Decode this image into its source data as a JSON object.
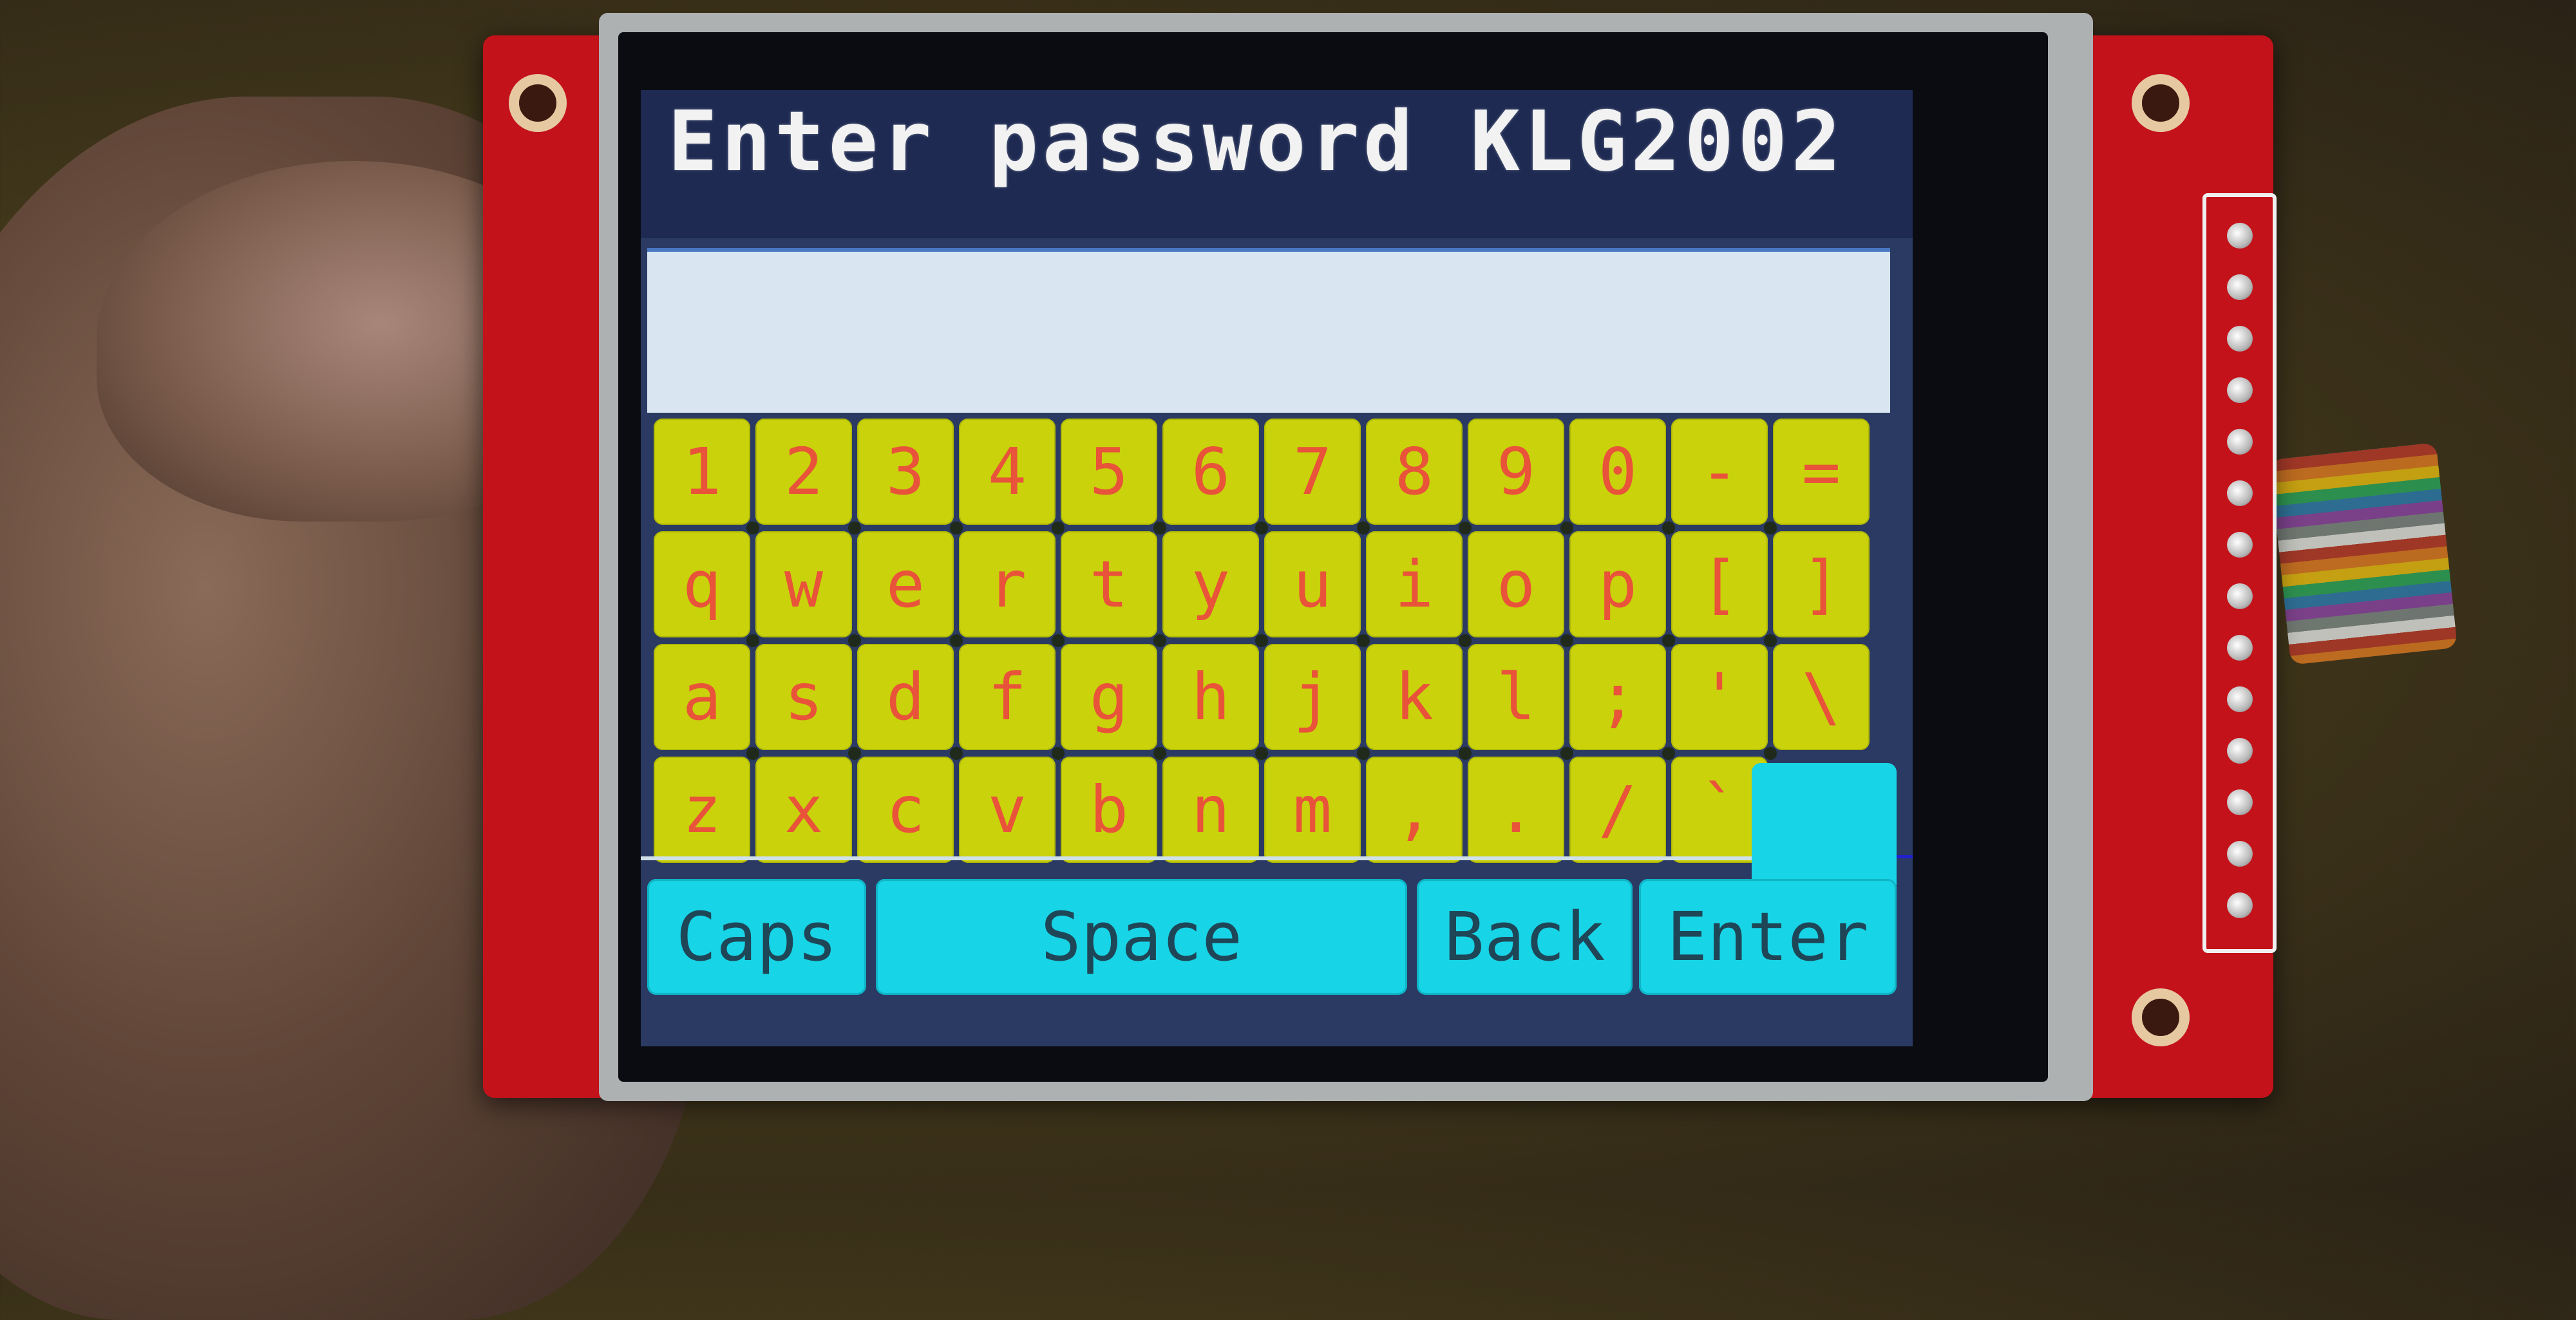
{
  "screen": {
    "title": "Enter password KLG2002",
    "password_value": ""
  },
  "keyboard": {
    "rows": [
      [
        "1",
        "2",
        "3",
        "4",
        "5",
        "6",
        "7",
        "8",
        "9",
        "0",
        "-",
        "="
      ],
      [
        "q",
        "w",
        "e",
        "r",
        "t",
        "y",
        "u",
        "i",
        "o",
        "p",
        "[",
        "]"
      ],
      [
        "a",
        "s",
        "d",
        "f",
        "g",
        "h",
        "j",
        "k",
        "l",
        ";",
        "'",
        "\\"
      ],
      [
        "z",
        "x",
        "c",
        "v",
        "b",
        "n",
        "m",
        ",",
        ".",
        "/",
        "`"
      ]
    ],
    "caps_label": "Caps",
    "space_label": "Space",
    "back_label": "Back",
    "enter_label": "Enter"
  },
  "colors": {
    "key_fill": "#c9d20a",
    "key_text": "#e8533a",
    "function_key_fill": "#17d4e6",
    "background": "#2a3a63",
    "pcb": "#c4121a"
  }
}
